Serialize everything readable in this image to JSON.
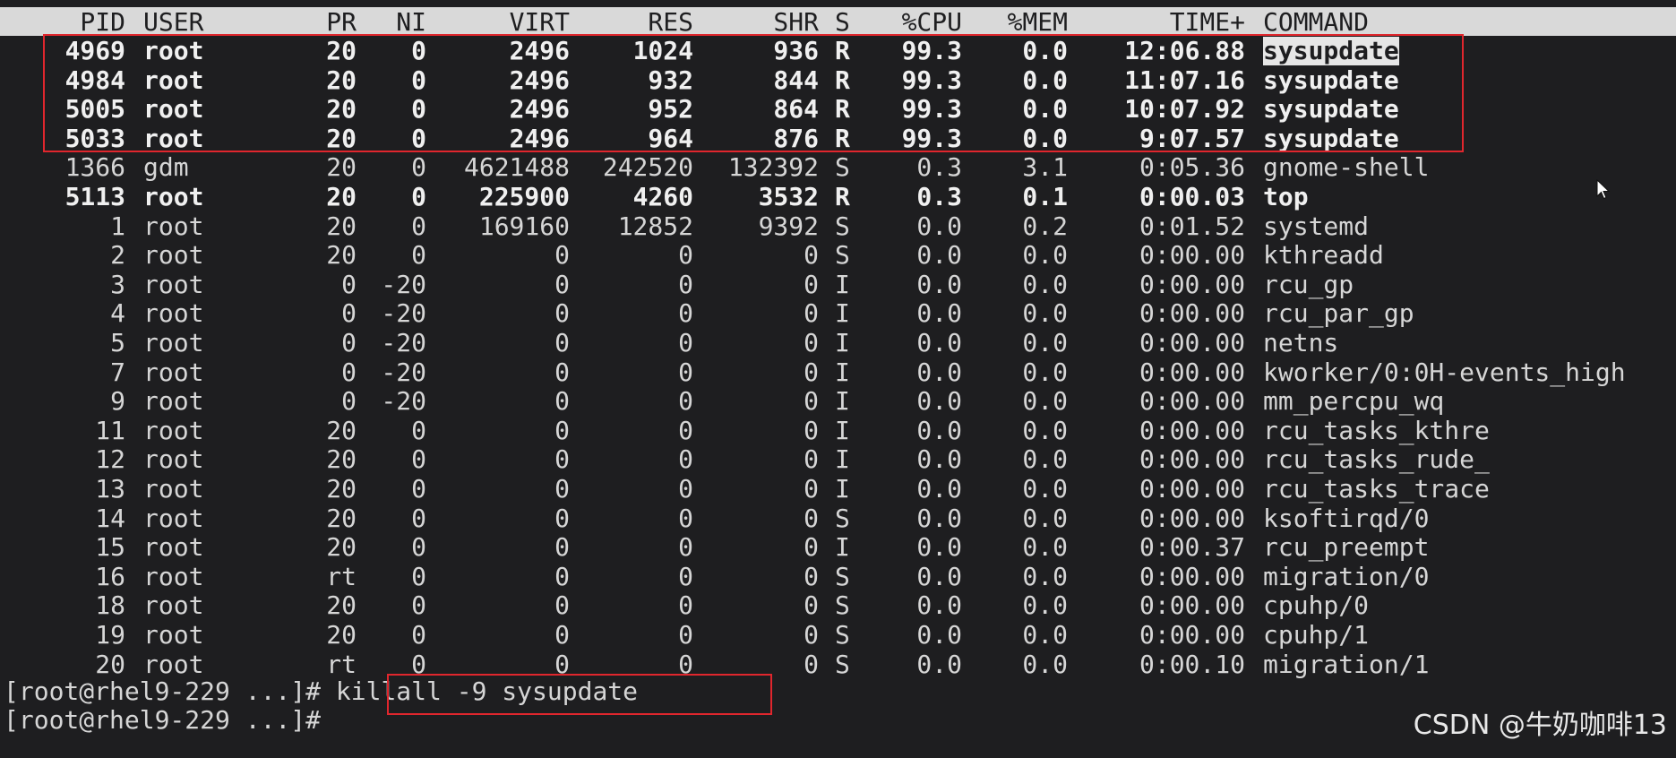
{
  "header": {
    "pid": "PID",
    "user": "USER",
    "pr": "PR",
    "ni": "NI",
    "virt": "VIRT",
    "res": "RES",
    "shr": "SHR",
    "s": "S",
    "cpu": "%CPU",
    "mem": "%MEM",
    "time": "TIME+",
    "command": "COMMAND"
  },
  "rows": [
    {
      "pid": "4969",
      "user": "root",
      "pr": "20",
      "ni": "0",
      "virt": "2496",
      "res": "1024",
      "shr": "936",
      "s": "R",
      "cpu": "99.3",
      "mem": "0.0",
      "time": "12:06.88",
      "command": "sysupdate"
    },
    {
      "pid": "4984",
      "user": "root",
      "pr": "20",
      "ni": "0",
      "virt": "2496",
      "res": "932",
      "shr": "844",
      "s": "R",
      "cpu": "99.3",
      "mem": "0.0",
      "time": "11:07.16",
      "command": "sysupdate"
    },
    {
      "pid": "5005",
      "user": "root",
      "pr": "20",
      "ni": "0",
      "virt": "2496",
      "res": "952",
      "shr": "864",
      "s": "R",
      "cpu": "99.3",
      "mem": "0.0",
      "time": "10:07.92",
      "command": "sysupdate"
    },
    {
      "pid": "5033",
      "user": "root",
      "pr": "20",
      "ni": "0",
      "virt": "2496",
      "res": "964",
      "shr": "876",
      "s": "R",
      "cpu": "99.3",
      "mem": "0.0",
      "time": "9:07.57",
      "command": "sysupdate"
    },
    {
      "pid": "1366",
      "user": "gdm",
      "pr": "20",
      "ni": "0",
      "virt": "4621488",
      "res": "242520",
      "shr": "132392",
      "s": "S",
      "cpu": "0.3",
      "mem": "3.1",
      "time": "0:05.36",
      "command": "gnome-shell"
    },
    {
      "pid": "5113",
      "user": "root",
      "pr": "20",
      "ni": "0",
      "virt": "225900",
      "res": "4260",
      "shr": "3532",
      "s": "R",
      "cpu": "0.3",
      "mem": "0.1",
      "time": "0:00.03",
      "command": "top"
    },
    {
      "pid": "1",
      "user": "root",
      "pr": "20",
      "ni": "0",
      "virt": "169160",
      "res": "12852",
      "shr": "9392",
      "s": "S",
      "cpu": "0.0",
      "mem": "0.2",
      "time": "0:01.52",
      "command": "systemd"
    },
    {
      "pid": "2",
      "user": "root",
      "pr": "20",
      "ni": "0",
      "virt": "0",
      "res": "0",
      "shr": "0",
      "s": "S",
      "cpu": "0.0",
      "mem": "0.0",
      "time": "0:00.00",
      "command": "kthreadd"
    },
    {
      "pid": "3",
      "user": "root",
      "pr": "0",
      "ni": "-20",
      "virt": "0",
      "res": "0",
      "shr": "0",
      "s": "I",
      "cpu": "0.0",
      "mem": "0.0",
      "time": "0:00.00",
      "command": "rcu_gp"
    },
    {
      "pid": "4",
      "user": "root",
      "pr": "0",
      "ni": "-20",
      "virt": "0",
      "res": "0",
      "shr": "0",
      "s": "I",
      "cpu": "0.0",
      "mem": "0.0",
      "time": "0:00.00",
      "command": "rcu_par_gp"
    },
    {
      "pid": "5",
      "user": "root",
      "pr": "0",
      "ni": "-20",
      "virt": "0",
      "res": "0",
      "shr": "0",
      "s": "I",
      "cpu": "0.0",
      "mem": "0.0",
      "time": "0:00.00",
      "command": "netns"
    },
    {
      "pid": "7",
      "user": "root",
      "pr": "0",
      "ni": "-20",
      "virt": "0",
      "res": "0",
      "shr": "0",
      "s": "I",
      "cpu": "0.0",
      "mem": "0.0",
      "time": "0:00.00",
      "command": "kworker/0:0H-events_high"
    },
    {
      "pid": "9",
      "user": "root",
      "pr": "0",
      "ni": "-20",
      "virt": "0",
      "res": "0",
      "shr": "0",
      "s": "I",
      "cpu": "0.0",
      "mem": "0.0",
      "time": "0:00.00",
      "command": "mm_percpu_wq"
    },
    {
      "pid": "11",
      "user": "root",
      "pr": "20",
      "ni": "0",
      "virt": "0",
      "res": "0",
      "shr": "0",
      "s": "I",
      "cpu": "0.0",
      "mem": "0.0",
      "time": "0:00.00",
      "command": "rcu_tasks_kthre"
    },
    {
      "pid": "12",
      "user": "root",
      "pr": "20",
      "ni": "0",
      "virt": "0",
      "res": "0",
      "shr": "0",
      "s": "I",
      "cpu": "0.0",
      "mem": "0.0",
      "time": "0:00.00",
      "command": "rcu_tasks_rude_"
    },
    {
      "pid": "13",
      "user": "root",
      "pr": "20",
      "ni": "0",
      "virt": "0",
      "res": "0",
      "shr": "0",
      "s": "I",
      "cpu": "0.0",
      "mem": "0.0",
      "time": "0:00.00",
      "command": "rcu_tasks_trace"
    },
    {
      "pid": "14",
      "user": "root",
      "pr": "20",
      "ni": "0",
      "virt": "0",
      "res": "0",
      "shr": "0",
      "s": "S",
      "cpu": "0.0",
      "mem": "0.0",
      "time": "0:00.00",
      "command": "ksoftirqd/0"
    },
    {
      "pid": "15",
      "user": "root",
      "pr": "20",
      "ni": "0",
      "virt": "0",
      "res": "0",
      "shr": "0",
      "s": "I",
      "cpu": "0.0",
      "mem": "0.0",
      "time": "0:00.37",
      "command": "rcu_preempt"
    },
    {
      "pid": "16",
      "user": "root",
      "pr": "rt",
      "ni": "0",
      "virt": "0",
      "res": "0",
      "shr": "0",
      "s": "S",
      "cpu": "0.0",
      "mem": "0.0",
      "time": "0:00.00",
      "command": "migration/0"
    },
    {
      "pid": "18",
      "user": "root",
      "pr": "20",
      "ni": "0",
      "virt": "0",
      "res": "0",
      "shr": "0",
      "s": "S",
      "cpu": "0.0",
      "mem": "0.0",
      "time": "0:00.00",
      "command": "cpuhp/0"
    },
    {
      "pid": "19",
      "user": "root",
      "pr": "20",
      "ni": "0",
      "virt": "0",
      "res": "0",
      "shr": "0",
      "s": "S",
      "cpu": "0.0",
      "mem": "0.0",
      "time": "0:00.00",
      "command": "cpuhp/1"
    },
    {
      "pid": "20",
      "user": "root",
      "pr": "rt",
      "ni": "0",
      "virt": "0",
      "res": "0",
      "shr": "0",
      "s": "S",
      "cpu": "0.0",
      "mem": "0.0",
      "time": "0:00.10",
      "command": "migration/1"
    }
  ],
  "bold_rows": [
    0,
    1,
    2,
    3,
    5
  ],
  "highlighted_command_row": 0,
  "prompt": {
    "line1_prefix": "[root@rhel9-229 ...]# ",
    "line1_command": "killall -9 sysupdate",
    "line2_prefix": "[root@rhel9-229 ...]# "
  },
  "watermark": "CSDN @牛奶咖啡13",
  "colors": {
    "background": "#1e1e20",
    "header_bg": "#d9d9d9",
    "annotation_box": "#e0262d",
    "text": "#d6d6d6"
  },
  "icons": {
    "mouse_cursor": "mouse-cursor-icon"
  }
}
